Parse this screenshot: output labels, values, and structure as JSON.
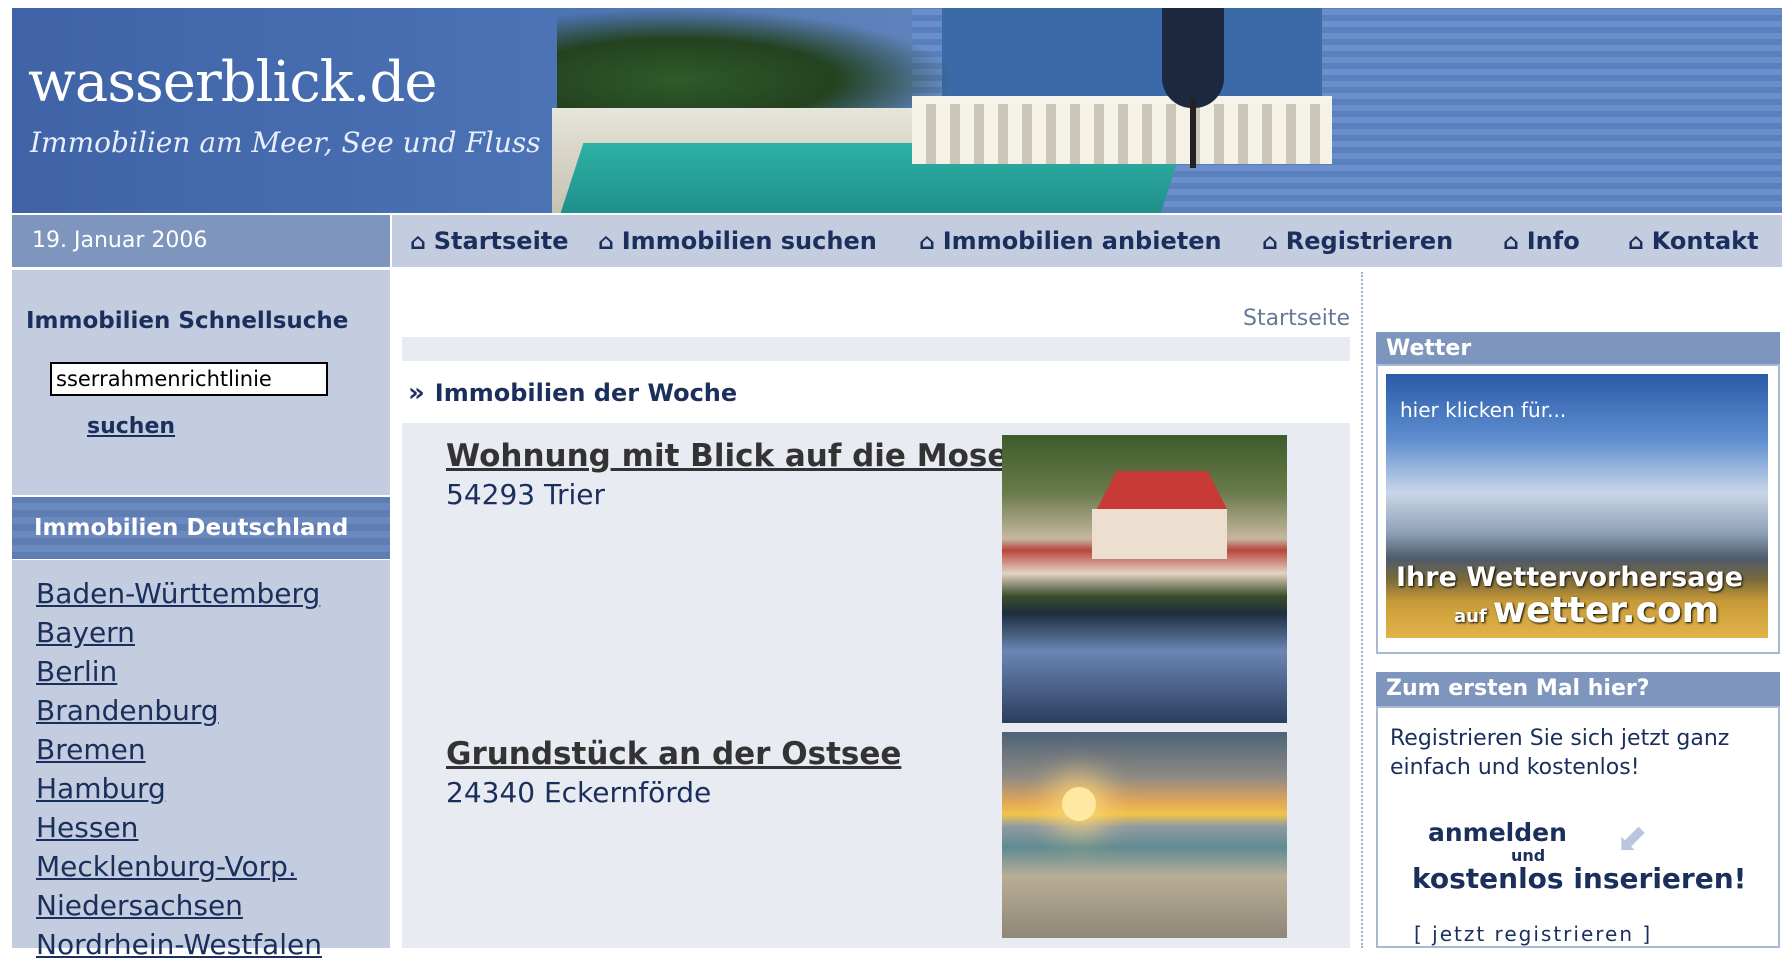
{
  "header": {
    "logo": "wasserblick.de",
    "tagline": "Immobilien am Meer, See und Fluss"
  },
  "date": "19. Januar 2006",
  "nav": {
    "items": [
      {
        "label": "Startseite",
        "icon": "home-icon"
      },
      {
        "label": "Immobilien suchen",
        "icon": "home-icon"
      },
      {
        "label": "Immobilien anbieten",
        "icon": "home-icon"
      },
      {
        "label": "Registrieren",
        "icon": "home-icon"
      },
      {
        "label": "Info",
        "icon": "home-icon"
      },
      {
        "label": "Kontakt",
        "icon": "home-icon"
      }
    ]
  },
  "quick_search": {
    "title": "Immobilien Schnellsuche",
    "input_value": "sserrahmenrichtlinie",
    "button_label": "suchen"
  },
  "regions": {
    "title": "Immobilien Deutschland",
    "items": [
      "Baden-Württemberg",
      "Bayern",
      "Berlin",
      "Brandenburg",
      "Bremen",
      "Hamburg",
      "Hessen",
      "Mecklenburg-Vorp.",
      "Niedersachsen",
      "Nordrhein-Westfalen"
    ]
  },
  "breadcrumb": "Startseite",
  "featured": {
    "title": "Immobilien der Woche",
    "listings": [
      {
        "title": "Wohnung mit Blick auf die Mosel",
        "location": "54293 Trier"
      },
      {
        "title": "Grundstück an der Ostsee",
        "location": "24340 Eckernförde"
      }
    ]
  },
  "weather": {
    "title": "Wetter",
    "ad_line1": "hier klicken für...",
    "ad_line2": "Ihre Wettervorhersage",
    "ad_line3_prefix": "auf",
    "ad_line3": "wetter.com"
  },
  "first_time": {
    "title": "Zum ersten Mal hier?",
    "text": "Registrieren Sie sich jetzt ganz einfach und kostenlos!",
    "cta_line1": "anmelden",
    "cta_und": "und",
    "cta_line2": "kostenlos inserieren!",
    "more_link": "[ jetzt registrieren ]"
  },
  "colors": {
    "nav_bg": "#c3cddf",
    "accent_blue": "#1b2f5c",
    "box_head": "#7e95bd"
  }
}
